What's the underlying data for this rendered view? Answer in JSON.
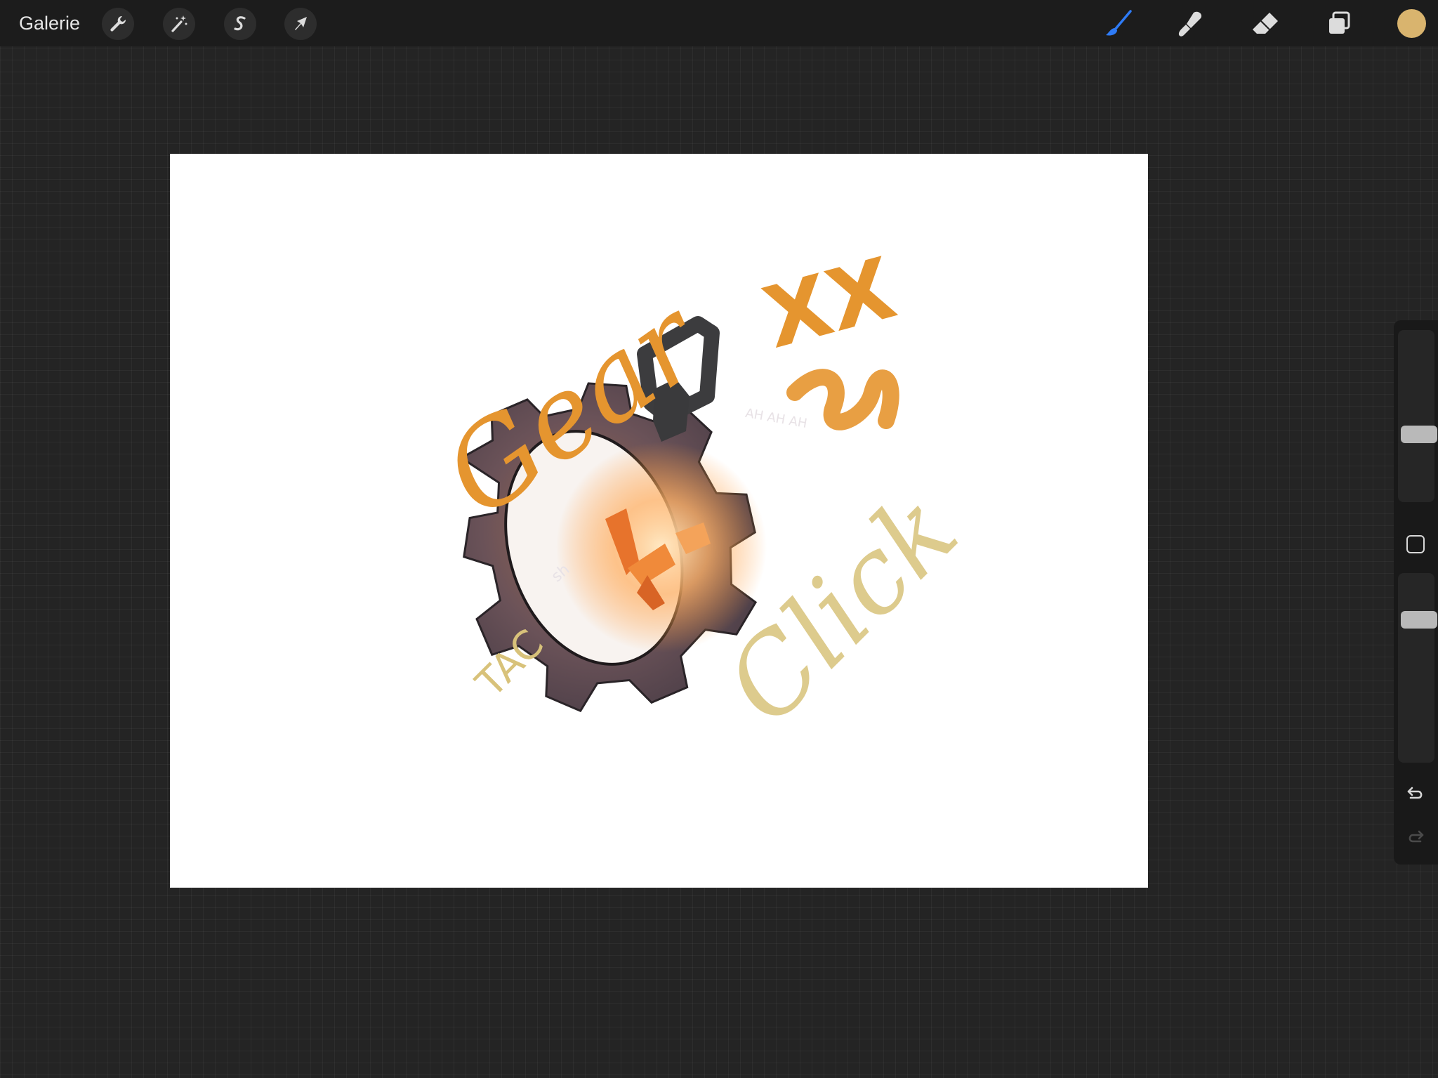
{
  "app": {
    "gallery_label": "Galerie"
  },
  "toolbar": {
    "left_tools": [
      {
        "name": "actions",
        "icon": "wrench-icon"
      },
      {
        "name": "adjustments",
        "icon": "magic-wand-icon"
      },
      {
        "name": "selection",
        "icon": "selection-s-icon"
      },
      {
        "name": "transform",
        "icon": "arrow-cursor-icon"
      }
    ],
    "right_tools": [
      {
        "name": "brush",
        "icon": "brush-icon",
        "active": true
      },
      {
        "name": "smudge",
        "icon": "smudge-icon",
        "active": false
      },
      {
        "name": "eraser",
        "icon": "eraser-icon",
        "active": false
      },
      {
        "name": "layers",
        "icon": "layers-icon",
        "active": false
      }
    ],
    "current_color": "#d9b46e",
    "active_color": "#2e7bf6"
  },
  "sidebar": {
    "brush_size": 0.38,
    "opacity": 0.78,
    "modify_icon": "square-icon",
    "undo_icon": "undo-icon",
    "redo_icon": "redo-icon"
  },
  "artwork": {
    "texts": [
      "Gear",
      "XX",
      "Click",
      "TAC",
      "AH AH AH",
      "sh"
    ],
    "colors": {
      "orange_text": "#e5952f",
      "gold_text": "#d8c27a",
      "gear_body": "#5a4a52",
      "gear_glow": "#ff9a3a",
      "ring": "#3c3c3e"
    }
  }
}
